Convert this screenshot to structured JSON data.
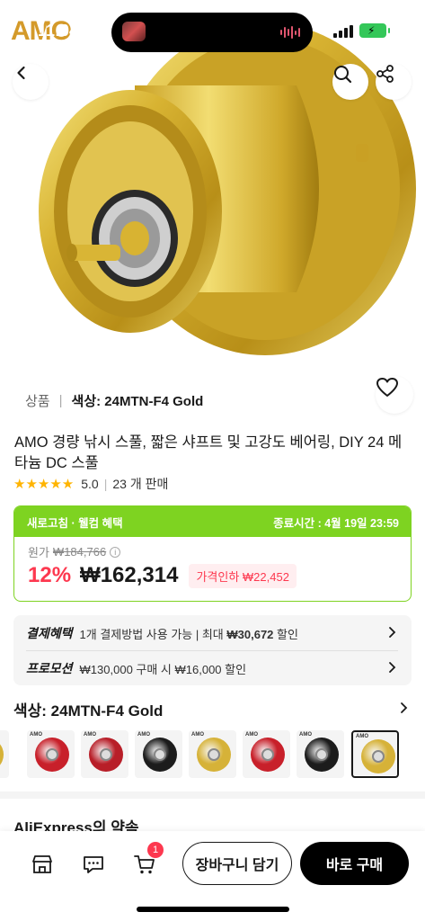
{
  "status_bar": {
    "time": "11:04",
    "brand": "AMO"
  },
  "header": {
    "back_icon": "chevron-left-icon",
    "search_icon": "search-icon",
    "share_icon": "share-icon"
  },
  "gallery": {
    "variant_label": "상품",
    "variant_value": "색상: 24MTN-F4 Gold",
    "wishlist_icon": "heart-icon"
  },
  "product": {
    "title": "AMO 경량 낚시 스풀, 짧은 샤프트 및 고강도 베어링, DIY 24 메타늄 DC 스풀",
    "rating_value": "5.0",
    "sold": "23 개 판매",
    "star_count": 5
  },
  "promo": {
    "badge": "새로고침 · 웰컴 혜택",
    "ends": "종료시간 : 4월 19일 23:59",
    "original_label": "원가",
    "original_price": "₩184,766",
    "discount": "12%",
    "price": "₩162,314",
    "price_drop": "가격인하 ₩22,452",
    "accent": "#7ed321",
    "sale_color": "#fd384f"
  },
  "benefits": [
    {
      "key": "결제혜택",
      "text_pre": "1개 결제방법 사용 가능 | 최대 ",
      "text_bold": "₩30,672",
      "text_post": " 할인"
    },
    {
      "key": "프로모션",
      "text_pre": "₩130,000 구매 시 ₩16,000 할인",
      "text_bold": "",
      "text_post": ""
    }
  ],
  "color": {
    "label": "색상: 24MTN-F4 Gold",
    "options": [
      {
        "name": "red",
        "color": "#c8202a"
      },
      {
        "name": "red-drilled",
        "color": "#b81e28"
      },
      {
        "name": "black",
        "color": "#1c1c1c"
      },
      {
        "name": "gold",
        "color": "#d6b238"
      },
      {
        "name": "red",
        "color": "#c8202a"
      },
      {
        "name": "black",
        "color": "#1c1c1c"
      },
      {
        "name": "gold",
        "color": "#d6b238"
      }
    ],
    "selected_index": 6
  },
  "section": {
    "promise_title": "AliExpress의 약속"
  },
  "bottom_bar": {
    "store_icon": "store-icon",
    "chat_icon": "chat-icon",
    "cart_icon": "cart-icon",
    "cart_count": "1",
    "add_to_cart": "장바구니 담기",
    "buy_now": "바로 구매"
  }
}
